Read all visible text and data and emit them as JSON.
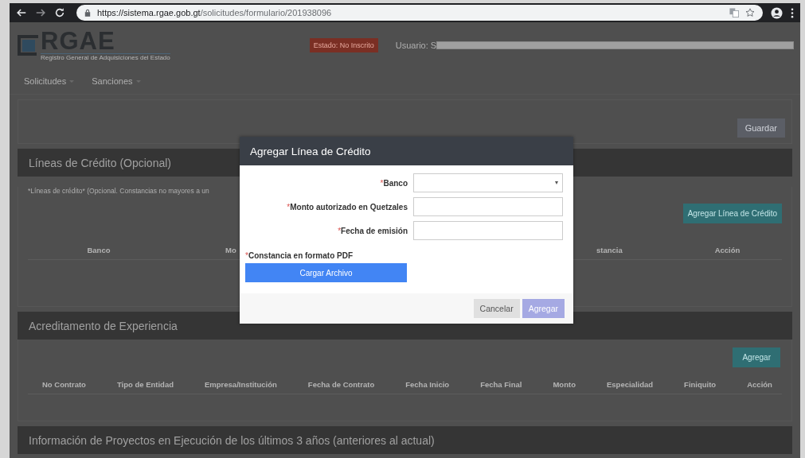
{
  "browser": {
    "url_host": "https://sistema.rgae.gob.gt",
    "url_path": "/solicitudes/formulario/201938096"
  },
  "header": {
    "logo_text": "RGAE",
    "logo_subtitle": "Registro General de Adquisiciones del Estado",
    "status_badge": "Estado: No Inscrito",
    "user_label": "Usuario: S"
  },
  "nav": [
    {
      "label": "Solicitudes"
    },
    {
      "label": "Sanciones"
    }
  ],
  "top_card": {
    "button": "Guardar"
  },
  "sections": [
    {
      "kind": "credit",
      "title": "Líneas de Crédito (Opcional)",
      "note": "*Líneas de crédito* (Opcional. Constancias no mayores a un",
      "button": "Agregar Línea de Crédito",
      "columns": [
        "Banco",
        "Mo",
        "stancia",
        "Acción"
      ]
    },
    {
      "kind": "experience",
      "title": "Acreditamento de Experiencia",
      "button": "Agregar",
      "columns": [
        "No Contrato",
        "Tipo de Entidad",
        "Empresa/Institución",
        "Fecha de Contrato",
        "Fecha Inicio",
        "Fecha Final",
        "Monto",
        "Especialidad",
        "Finiquito",
        "Acción"
      ]
    },
    {
      "kind": "plain",
      "title": "Información de Proyectos en Ejecución de los últimos 3 años (anteriores al actual)"
    }
  ],
  "modal": {
    "title": "Agregar Línea de Crédito",
    "fields": [
      {
        "kind": "select",
        "mark": "*",
        "label": "Banco"
      },
      {
        "kind": "text",
        "mark": "*",
        "label": "Monto autorizado en Quetzales"
      },
      {
        "kind": "text",
        "mark": "*",
        "label": "Fecha de emisión"
      }
    ],
    "upload": {
      "mark": "*",
      "label": "Constancia en formato PDF",
      "button": "Cargar Archivo"
    },
    "buttons": [
      {
        "kind": "cancel",
        "label": "Cancelar"
      },
      {
        "kind": "submit",
        "label": "Agregar"
      }
    ]
  }
}
